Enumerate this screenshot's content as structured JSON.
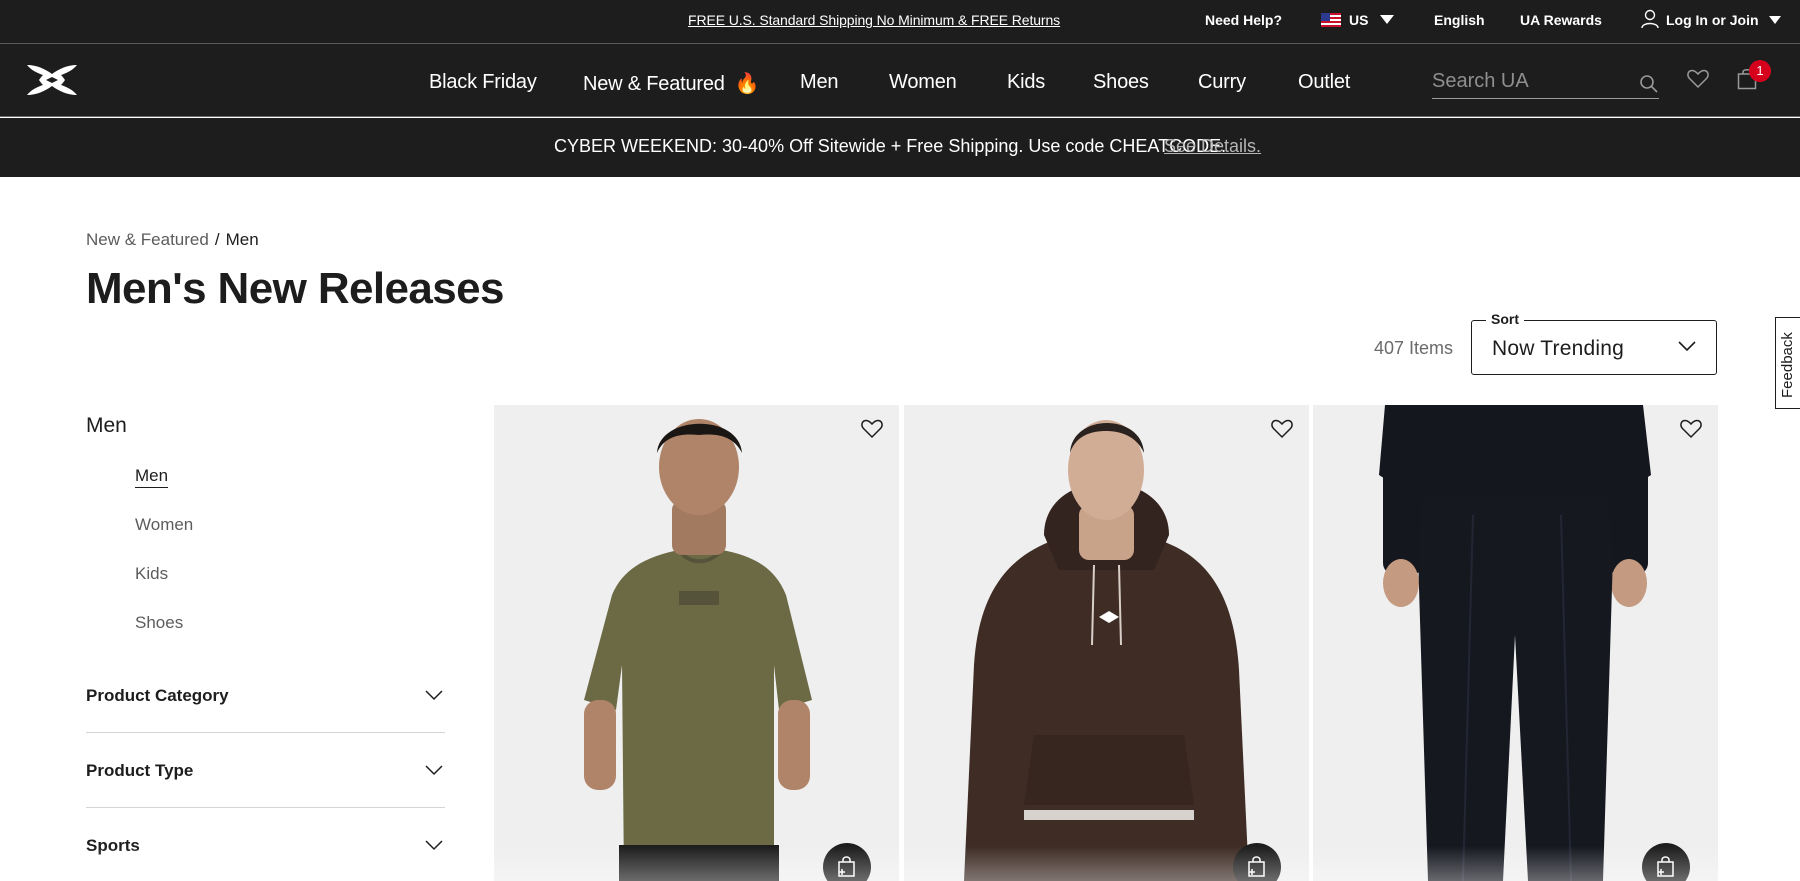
{
  "utility_bar": {
    "promo": "FREE U.S. Standard Shipping No Minimum & FREE Returns",
    "need_help": "Need Help?",
    "country": "US",
    "language": "English",
    "rewards": "UA Rewards",
    "login": "Log In or Join"
  },
  "nav": {
    "logo_icon": "under-armour-logo",
    "items": [
      "Black Friday",
      "New & Featured",
      "Men",
      "Women",
      "Kids",
      "Shoes",
      "Curry",
      "Outlet"
    ],
    "new_featured_icon": "🔥",
    "search_placeholder": "Search UA",
    "cart_count": "1"
  },
  "banner": {
    "message": "CYBER WEEKEND: 30-40% Off Sitewide + Free Shipping. Use code CHEATCODE.",
    "link": "See Details."
  },
  "breadcrumb": {
    "parent": "New & Featured",
    "separator": "/",
    "current": "Men"
  },
  "page_title": "Men's New Releases",
  "results": {
    "count": "407 Items",
    "sort_label": "Sort",
    "sort_value": "Now Trending"
  },
  "feedback_tab": "Feedback",
  "sidebar": {
    "heading": "Men",
    "items": [
      "Men",
      "Women",
      "Kids",
      "Shoes"
    ],
    "active_item": "Men",
    "facets": [
      "Product Category",
      "Product Type",
      "Sports"
    ]
  },
  "products": [
    {
      "image": "men-olive-acid-wash-tee",
      "color": "#6b6a45"
    },
    {
      "image": "men-brown-hoodie",
      "color": "#3e2c25"
    },
    {
      "image": "men-black-pants",
      "color": "#161820"
    }
  ],
  "colors": {
    "header_bg": "#1d1d1d",
    "card_bg": "#f0f0f0",
    "badge": "#d6001c"
  }
}
